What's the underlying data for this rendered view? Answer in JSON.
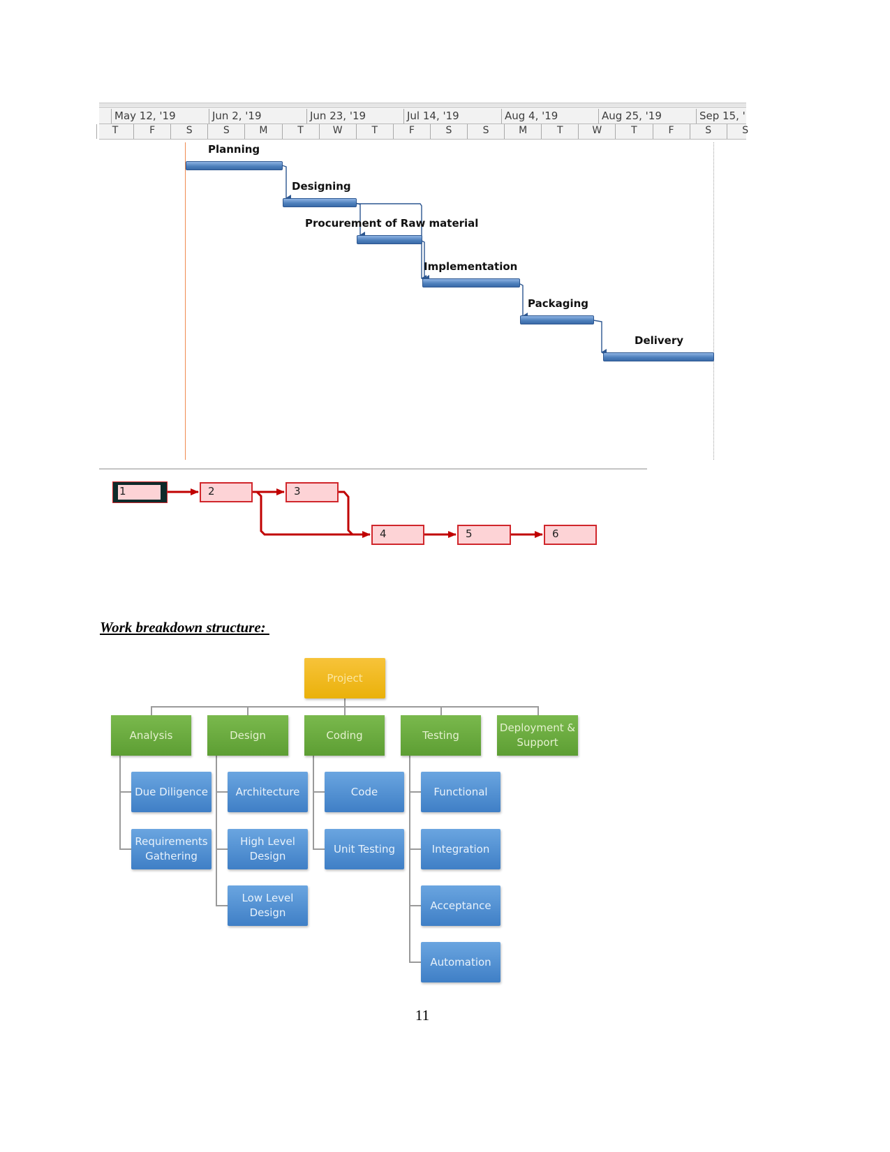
{
  "gantt": {
    "week_labels": [
      "May 12, '19",
      "Jun 2, '19",
      "Jun 23, '19",
      "Jul 14, '19",
      "Aug 4, '19",
      "Aug 25, '19",
      "Sep 15, '"
    ],
    "day_labels": [
      "T",
      "F",
      "S",
      "S",
      "M",
      "T",
      "W",
      "T",
      "F",
      "S",
      "S",
      "M",
      "T",
      "W",
      "T",
      "F",
      "S",
      "S"
    ],
    "tasks": [
      {
        "id": 1,
        "name": "Planning"
      },
      {
        "id": 2,
        "name": "Designing"
      },
      {
        "id": 3,
        "name": "Procurement of Raw material"
      },
      {
        "id": 4,
        "name": "Implementation"
      },
      {
        "id": 5,
        "name": "Packaging"
      },
      {
        "id": 6,
        "name": "Delivery"
      }
    ],
    "bar_color": "#4f81bd",
    "status_line_color": "#f08a50"
  },
  "network": {
    "nodes": [
      "1",
      "2",
      "3",
      "4",
      "5",
      "6"
    ],
    "links": [
      [
        "1",
        "2"
      ],
      [
        "2",
        "3"
      ],
      [
        "2",
        "4"
      ],
      [
        "3",
        "4"
      ],
      [
        "4",
        "5"
      ],
      [
        "5",
        "6"
      ]
    ],
    "line_color": "#c00000",
    "node_fill": "#fdd3d6"
  },
  "wbs": {
    "heading": "Work breakdown structure: ",
    "root": "Project",
    "branches": [
      {
        "label": "Analysis",
        "children": [
          "Due Diligence",
          "Requirements Gathering"
        ]
      },
      {
        "label": "Design",
        "children": [
          "Architecture",
          "High Level Design",
          "Low Level Design"
        ]
      },
      {
        "label": "Coding",
        "children": [
          "Code",
          "Unit Testing"
        ]
      },
      {
        "label": "Testing",
        "children": [
          "Functional",
          "Integration",
          "Acceptance",
          "Automation"
        ]
      },
      {
        "label": "Deployment & Support",
        "children": []
      }
    ]
  },
  "page_number": "11"
}
